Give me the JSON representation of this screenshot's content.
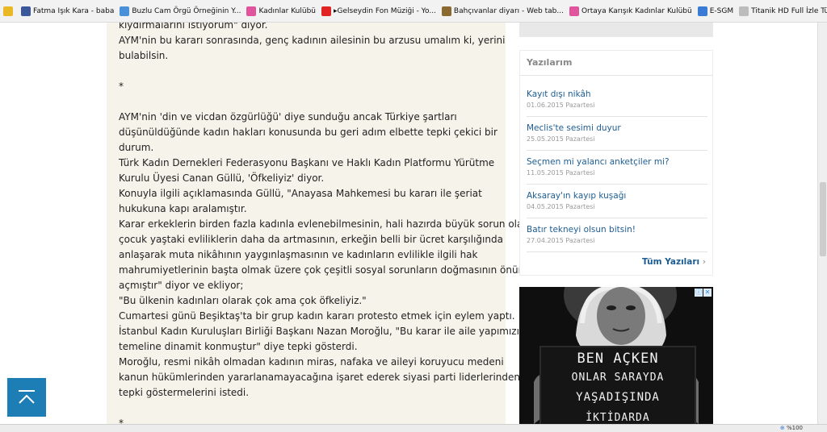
{
  "bookmarks": [
    {
      "label": "",
      "icon": "star-add-icon",
      "color": "#e9b824"
    },
    {
      "label": "Fatma Işık Kara - baba",
      "icon": "facebook-icon",
      "color": "#3b5998"
    },
    {
      "label": "Buzlu Cam Örgü Örneğinin Y...",
      "icon": "globe-icon",
      "color": "#4a90d9"
    },
    {
      "label": "Kadınlar Kulübü",
      "icon": "kadinlar-kulubu-icon",
      "color": "#e0549e"
    },
    {
      "label": "▸Gelseydin Fon Müziği - Yo...",
      "icon": "youtube-icon",
      "color": "#e02424"
    },
    {
      "label": "Bahçıvanlar diyarı - Web tab...",
      "icon": "garden-icon",
      "color": "#8a6a2e"
    },
    {
      "label": "Ortaya Karışık  Kadınlar Kulübü",
      "icon": "kadinlar-kulubu-icon",
      "color": "#e0549e"
    },
    {
      "label": "E-SGM",
      "icon": "e-icon",
      "color": "#3a7bd5"
    },
    {
      "label": "Titanik HD Full İzle Türkçe D...",
      "icon": "page-icon",
      "color": "#bcbcbc"
    }
  ],
  "article": {
    "lines": [
      "kıydırmalarını istiyorum\" diyor.",
      "AYM'nin bu kararı sonrasında, genç kadının ailesinin bu arzusu umalım ki, yerini",
      "bulabilsin.",
      "*",
      "AYM'nin 'din ve vicdan özgürlüğü' diye sunduğu ancak Türkiye şartları",
      "düşünüldüğünde kadın hakları konusunda bu geri adım elbette tepki çekici bir",
      "durum.",
      "Türk Kadın Dernekleri Federasyonu Başkanı ve Haklı Kadın Platformu Yürütme",
      "Kurulu Üyesi Canan Güllü, 'Öfkeliyiz' diyor.",
      "Konuyla ilgili açıklamasında Güllü, \"Anayasa Mahkemesi bu kararı ile şeriat",
      "hukukuna kapı aralamıştır.",
      "Karar erkeklerin birden fazla kadınla evlenebilmesinin, hali hazırda büyük sorun olan",
      "çocuk yaştaki evliliklerin daha da artmasının, erkeğin belli bir ücret karşılığında",
      "anlaşarak muta nikâhının yaygınlaşmasının ve kadınların evlilikle ilgili hak",
      "mahrumiyetlerinin başta olmak üzere çok çeşitli sosyal sorunların doğmasının önünü",
      "açmıştır\" diyor ve ekliyor;",
      "\"Bu ülkenin kadınları olarak çok ama çok öfkeliyiz.\"",
      "Cumartesi günü Beşiktaş'ta bir grup kadın kararı protesto etmek için eylem yaptı.",
      "İstanbul Kadın Kuruluşları Birliği Başkanı Nazan Moroğlu, \"Bu karar ile aile yapımızın",
      "temeline dinamit konmuştur\" diye tepki gösterdi.",
      "Moroğlu, resmi nikâh olmadan kadının miras, nafaka ve aileyi koruyucu medeni",
      "kanun hükümlerinden yararlanamayacağına işaret ederek siyasi parti liderlerinden",
      "tepki göstermelerini istedi.",
      "*"
    ]
  },
  "sidebar": {
    "title": "Yazılarım",
    "posts": [
      {
        "title": "Kayıt dışı nikâh",
        "date": "01.06.2015 Pazartesi"
      },
      {
        "title": "Meclis'te sesimi duyur",
        "date": "25.05.2015 Pazartesi"
      },
      {
        "title": "Seçmen mi yalancı anketçiler mi?",
        "date": "11.05.2015 Pazartesi"
      },
      {
        "title": "Aksaray'ın kayıp kuşağı",
        "date": "04.05.2015 Pazartesi"
      },
      {
        "title": "Batır tekneyi olsun bitsin!",
        "date": "27.04.2015 Pazartesi"
      }
    ],
    "all_posts": "Tüm Yazıları",
    "all_posts_chevron": "›"
  },
  "ad": {
    "choices_glyph": "ⓘ",
    "close_glyph": "✕",
    "board_lines": [
      "BEN AÇKEN",
      "ONLAR SARAYDA",
      "YAŞADIŞINDA",
      "İKTİDARDA"
    ]
  },
  "statusbar": {
    "zoom": "%100"
  },
  "colors": {
    "link": "#1d5d93",
    "scroll_button": "#1d7db5",
    "article_bg": "#f6f3ea"
  }
}
